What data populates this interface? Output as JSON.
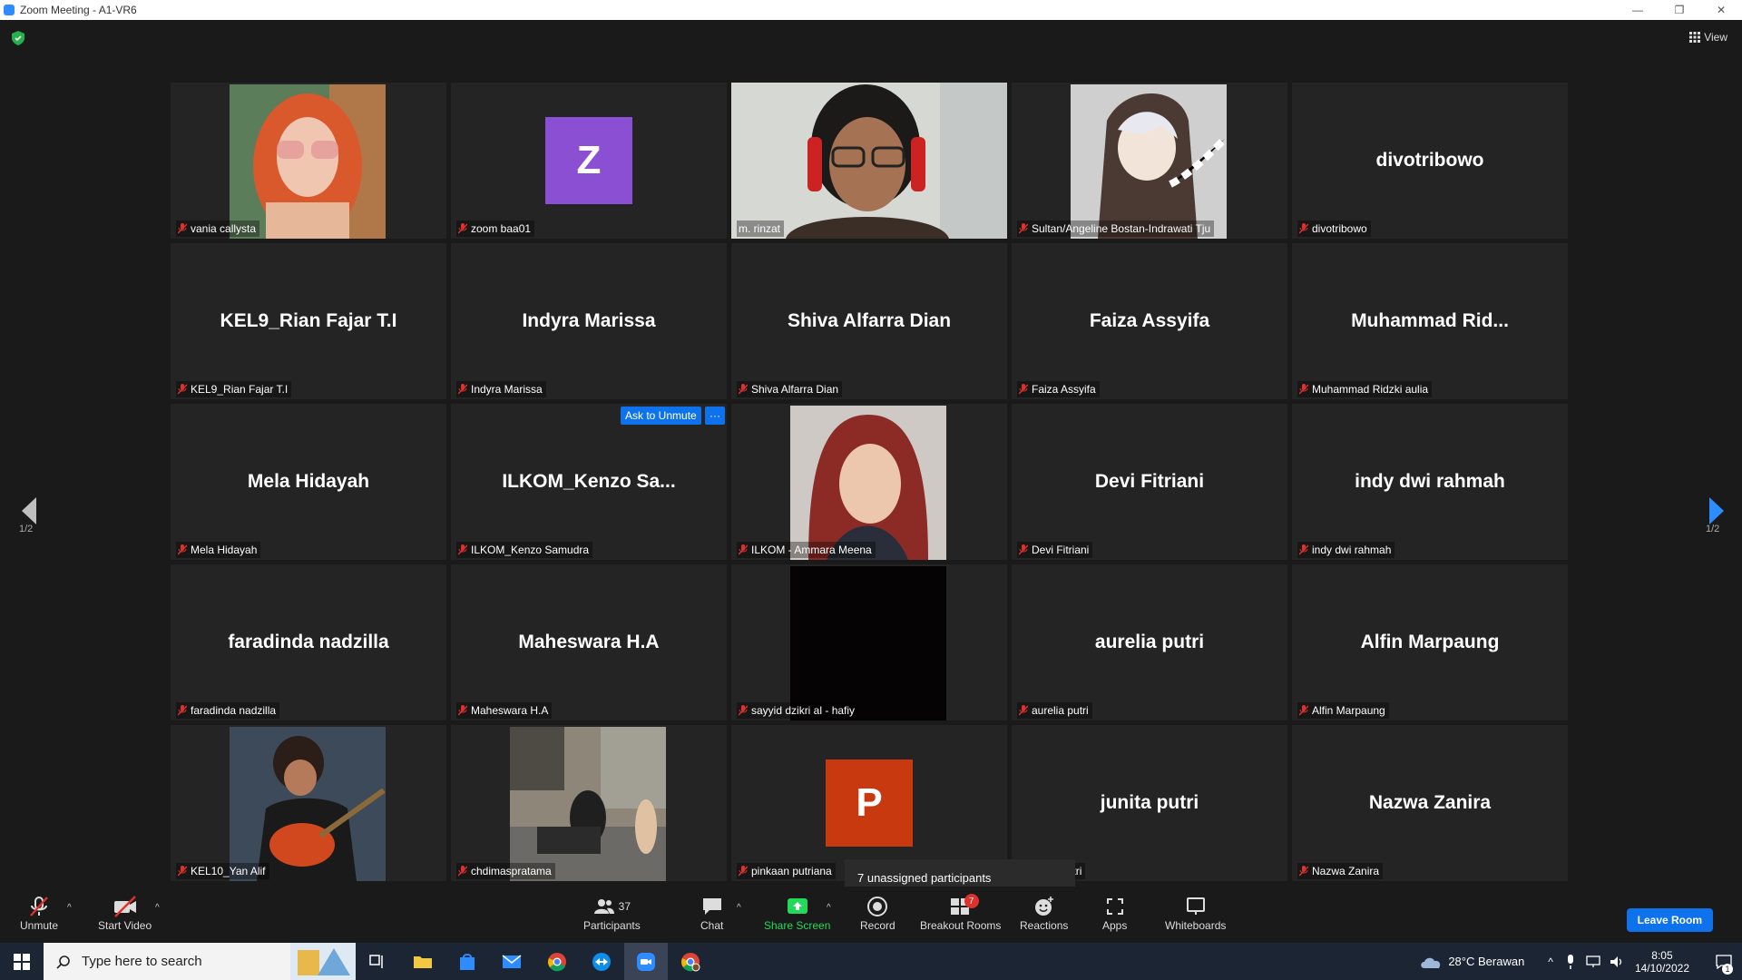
{
  "window": {
    "title": "Zoom Meeting - A1-VR6",
    "minimize": "—",
    "restore": "❐",
    "close": "✕"
  },
  "header": {
    "view_label": "View"
  },
  "tiles": [
    {
      "big": "",
      "label": "vania callysta",
      "kind": "photo",
      "photo": "woman-red-hair"
    },
    {
      "big": "",
      "label": "zoom baa01",
      "kind": "letter",
      "letter": "Z",
      "color": "#8a4fd3"
    },
    {
      "big": "",
      "label": "m. rinzat",
      "kind": "video",
      "active": true
    },
    {
      "big": "",
      "label": "Sultan/Angeline Bostan-Indrawati Tju",
      "kind": "photo",
      "photo": "anime-hood"
    },
    {
      "big": "divotribowo",
      "label": "divotribowo",
      "kind": "name"
    },
    {
      "big": "KEL9_Rian Fajar T.I",
      "label": "KEL9_Rian Fajar T.I",
      "kind": "name"
    },
    {
      "big": "Indyra Marissa",
      "label": "Indyra Marissa",
      "kind": "name"
    },
    {
      "big": "Shiva Alfarra Dian",
      "label": "Shiva Alfarra Dian",
      "kind": "name"
    },
    {
      "big": "Faiza Assyifa",
      "label": "Faiza Assyifa",
      "kind": "name"
    },
    {
      "big": "Muhammad  Rid...",
      "label": "Muhammad Ridzki aulia",
      "kind": "name"
    },
    {
      "big": "Mela Hidayah",
      "label": "Mela Hidayah",
      "kind": "name"
    },
    {
      "big": "ILKOM_Kenzo  Sa...",
      "label": "ILKOM_Kenzo Samudra",
      "kind": "name"
    },
    {
      "big": "",
      "label": "ILKOM - Ammara Meena",
      "kind": "photo",
      "photo": "hijab"
    },
    {
      "big": "Devi Fitriani",
      "label": "Devi Fitriani",
      "kind": "name"
    },
    {
      "big": "indy dwi rahmah",
      "label": "indy dwi rahmah",
      "kind": "name"
    },
    {
      "big": "faradinda nadzilla",
      "label": "faradinda nadzilla",
      "kind": "name"
    },
    {
      "big": "Maheswara H.A",
      "label": "Maheswara H.A",
      "kind": "name"
    },
    {
      "big": "",
      "label": "sayyid dzikri al - hafiy",
      "kind": "photo",
      "photo": "black"
    },
    {
      "big": "aurelia putri",
      "label": "aurelia putri",
      "kind": "name"
    },
    {
      "big": "Alfin Marpaung",
      "label": "Alfin Marpaung",
      "kind": "name"
    },
    {
      "big": "",
      "label": "KEL10_Yan Alif",
      "kind": "photo",
      "photo": "guitar"
    },
    {
      "big": "",
      "label": "chdimaspratama",
      "kind": "photo",
      "photo": "street"
    },
    {
      "big": "",
      "label": "pinkaan putriana",
      "kind": "letter",
      "letter": "P",
      "color": "#c8390f"
    },
    {
      "big": "junita putri",
      "label": "junita putri",
      "kind": "name"
    },
    {
      "big": "Nazwa Zanira",
      "label": "Nazwa Zanira",
      "kind": "name"
    }
  ],
  "ask_unmute": {
    "label": "Ask to Unmute",
    "more": "···"
  },
  "pagination": {
    "left": "1/2",
    "right": "1/2"
  },
  "tooltip": {
    "text": "7 unassigned participants"
  },
  "toolbar": {
    "unmute": "Unmute",
    "start_video": "Start Video",
    "participants": "Participants",
    "participants_count": "37",
    "chat": "Chat",
    "share_screen": "Share Screen",
    "record": "Record",
    "breakout_rooms": "Breakout Rooms",
    "breakout_badge": "7",
    "reactions": "Reactions",
    "apps": "Apps",
    "whiteboards": "Whiteboards",
    "leave": "Leave Room"
  },
  "taskbar": {
    "search_placeholder": "Type here to search",
    "weather": "28°C  Berawan",
    "time": "8:05",
    "date": "14/10/2022",
    "notification_count": "1"
  },
  "colors": {
    "accent": "#0e72ed",
    "active_border": "#e4e75a",
    "share_green": "#23d959"
  }
}
